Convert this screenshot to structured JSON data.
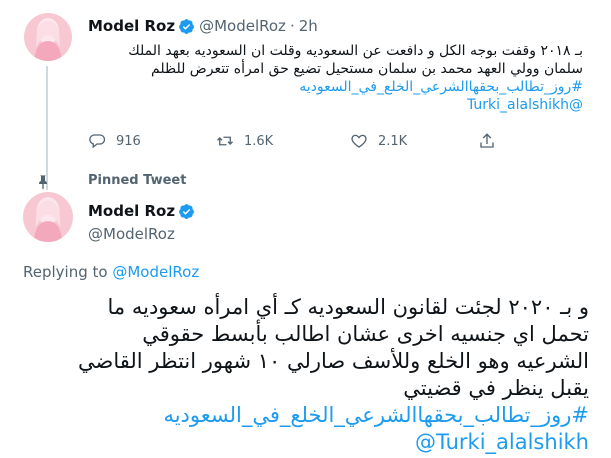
{
  "pinned_tweet_above": {
    "author_name": "Model Roz",
    "handle": "@ModelRoz",
    "separator": "·",
    "time": "2h",
    "text_lines": [
      "بـ ٢٠١٨ وقفت بوجه الكل و دافعت عن السعوديه وقلت ان السعوديه بعهد الملك",
      "سلمان وولي العهد محمد بن سلمان مستحيل تضيع حق امرأه تتعرض للظلم"
    ],
    "hashtag": "#روز_تطالب_بحقهاالشرعي_الخلع_في_السعوديه",
    "mention": "@Turki_alalshikh",
    "counts": {
      "replies": "916",
      "retweets": "1.6K",
      "likes": "2.1K"
    }
  },
  "pinned_label": "Pinned Tweet",
  "main_tweet": {
    "author_name": "Model Roz",
    "handle": "@ModelRoz",
    "replying_prefix": "Replying to",
    "replying_to": "@ModelRoz",
    "text_lines": [
      "و بـ ٢٠٢٠ لجئت لقانون السعوديه كـ أي امرأه سعوديه ما",
      "تحمل اي جنسيه اخرى عشان اطالب بأبسط حقوقي",
      "الشرعيه وهو الخلع وللأسف صارلي ١٠ شهور انتظر القاضي",
      "يقبل ينظر في قضيتي"
    ],
    "hashtag": "#روز_تطالب_بحقهاالشرعي_الخلع_في_السعوديه",
    "mention": "@Turki_alalshikh"
  },
  "colors": {
    "link": "#1d9bf0",
    "secondary_text": "#536471",
    "verified_badge": "#1d9bf0",
    "avatar_bg": "#f6c3cf"
  },
  "icons": [
    "verified-icon",
    "reply-icon",
    "retweet-icon",
    "like-icon",
    "share-icon",
    "pin-icon"
  ]
}
